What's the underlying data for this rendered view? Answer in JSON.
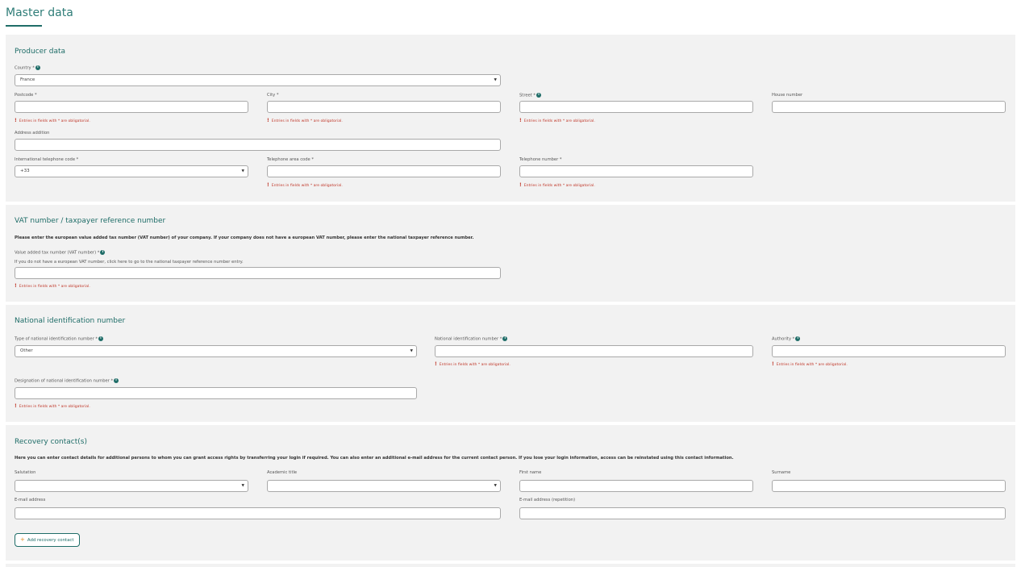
{
  "page": {
    "title": "Master data"
  },
  "common": {
    "error": "Entries in fields with * are obligatorial."
  },
  "producer": {
    "title": "Producer data",
    "country_label": "Country *",
    "country_value": "France",
    "postcode_label": "Postcode *",
    "city_label": "City *",
    "street_label": "Street *",
    "house_label": "House number",
    "address_addition_label": "Address addition",
    "intl_code_label": "International telephone code *",
    "intl_code_value": "+33",
    "area_code_label": "Telephone area code *",
    "phone_label": "Telephone number *"
  },
  "vat": {
    "title": "VAT number / taxpayer reference number",
    "description": "Please enter the european value added tax number (VAT number) of your company. If your company does not have a european VAT number, please enter the national taxpayer reference number.",
    "field_label": "Value added tax number (VAT number) *",
    "hint": "If you do not have a european VAT number, click here to go to the national taxpayer reference number entry."
  },
  "nid": {
    "title": "National identification number",
    "type_label": "Type of national identification number *",
    "type_value": "Other",
    "number_label": "National identification number *",
    "authority_label": "Authority *",
    "designation_label": "Designation of national identification number *"
  },
  "recovery": {
    "title": "Recovery contact(s)",
    "description": "Here you can enter contact details for additional persons to whom you can grant access rights by transferring your login if required. You can also enter an additional e-mail address for the current contact person. If you lose your login information, access can be reinstated using this contact information.",
    "salutation_label": "Salutation",
    "academic_label": "Academic title",
    "first_name_label": "First name",
    "surname_label": "Surname",
    "email_label": "E-mail address",
    "email_repeat_label": "E-mail address (repetition)",
    "add_button": "Add recovery contact"
  },
  "icons": {
    "info": "info-icon",
    "caret": "chevron-down-icon",
    "error": "exclamation-icon",
    "add": "plus-icon"
  },
  "colors": {
    "accent": "#1f6d68",
    "error": "#c0392b",
    "panel": "#f2f2f2"
  }
}
